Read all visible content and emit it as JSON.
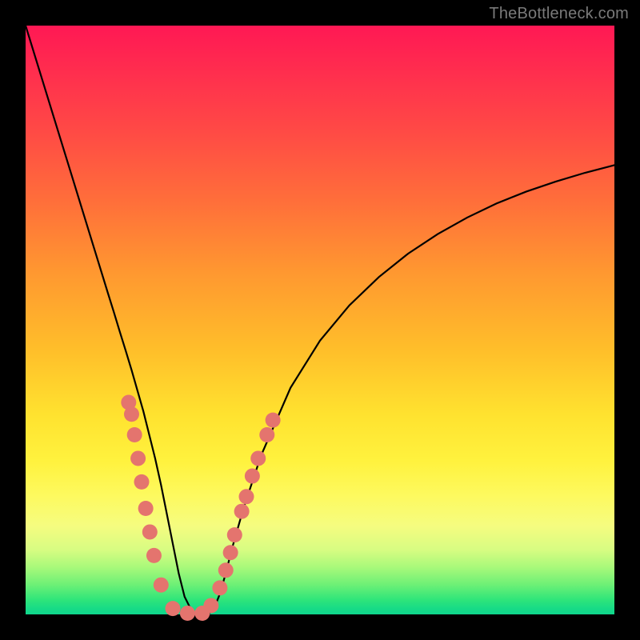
{
  "watermark": "TheBottleneck.com",
  "colors": {
    "frame": "#000000",
    "curve_stroke": "#000000",
    "dot_fill": "#e4746e",
    "gradient_stops": [
      "#ff1854",
      "#ff2e4e",
      "#ff4a45",
      "#ff6f3a",
      "#ff9830",
      "#ffbe2a",
      "#ffe22f",
      "#fff23e",
      "#fdfa60",
      "#f5fc80",
      "#d8fc82",
      "#a8f97a",
      "#6cf076",
      "#2fe57a",
      "#17db86",
      "#0fd68c"
    ]
  },
  "chart_data": {
    "type": "line",
    "title": "",
    "xlabel": "",
    "ylabel": "",
    "xlim": [
      0,
      100
    ],
    "ylim": [
      0,
      100
    ],
    "x": [
      0,
      2,
      4,
      6,
      8,
      10,
      12,
      14,
      15,
      16,
      17,
      18,
      19,
      20,
      21,
      22,
      23,
      24,
      25,
      26,
      27,
      28,
      29,
      30,
      31,
      32,
      33,
      34,
      35,
      37,
      40,
      45,
      50,
      55,
      60,
      65,
      70,
      75,
      80,
      85,
      90,
      95,
      100
    ],
    "y": [
      100,
      93.5,
      87,
      80.5,
      74,
      67.5,
      61,
      54.5,
      51.3,
      48,
      44.8,
      41.5,
      38,
      34.5,
      30.5,
      26.5,
      22,
      17,
      12,
      7,
      3,
      1,
      0,
      0,
      0,
      1,
      3.5,
      7,
      11,
      18,
      27,
      38.5,
      46.5,
      52.5,
      57.3,
      61.3,
      64.6,
      67.4,
      69.8,
      71.8,
      73.5,
      75,
      76.3
    ],
    "annotations_dots": {
      "comment": "salmon circular markers, mostly clustered on both branches near the trough; values given as {x,y} on the same 0–100 axis scale",
      "points": [
        {
          "x": 17.5,
          "y": 36.0
        },
        {
          "x": 18.0,
          "y": 34.0
        },
        {
          "x": 18.5,
          "y": 30.5
        },
        {
          "x": 19.1,
          "y": 26.5
        },
        {
          "x": 19.7,
          "y": 22.5
        },
        {
          "x": 20.4,
          "y": 18.0
        },
        {
          "x": 21.1,
          "y": 14.0
        },
        {
          "x": 21.8,
          "y": 10.0
        },
        {
          "x": 23.0,
          "y": 5.0
        },
        {
          "x": 25.0,
          "y": 1.0
        },
        {
          "x": 27.5,
          "y": 0.2
        },
        {
          "x": 30.0,
          "y": 0.2
        },
        {
          "x": 31.5,
          "y": 1.5
        },
        {
          "x": 33.0,
          "y": 4.5
        },
        {
          "x": 34.0,
          "y": 7.5
        },
        {
          "x": 34.8,
          "y": 10.5
        },
        {
          "x": 35.5,
          "y": 13.5
        },
        {
          "x": 36.7,
          "y": 17.5
        },
        {
          "x": 37.5,
          "y": 20.0
        },
        {
          "x": 38.5,
          "y": 23.5
        },
        {
          "x": 39.5,
          "y": 26.5
        },
        {
          "x": 41.0,
          "y": 30.5
        },
        {
          "x": 42.0,
          "y": 33.0
        }
      ]
    }
  }
}
